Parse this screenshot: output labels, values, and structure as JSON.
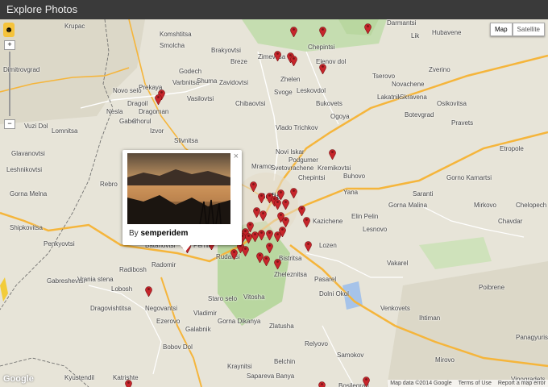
{
  "window": {
    "title": "Explore Photos"
  },
  "map_type": {
    "map": "Map",
    "satellite": "Satellite",
    "selected": "Map"
  },
  "zoom": {
    "in": "+",
    "out": "−"
  },
  "popup": {
    "by": "By",
    "author": "semperidem",
    "close": "×"
  },
  "attribution": {
    "data": "Map data ©2014 Google",
    "terms": "Terms of Use",
    "report": "Report a map error"
  },
  "logo": "Google",
  "colors": {
    "pin": "#c7252b",
    "park": "#b9d7a0",
    "highway": "#f5b53b",
    "road": "#ffffff",
    "water": "#a6c3e9",
    "border": "#555555"
  },
  "place_labels": [
    {
      "id": "krupac",
      "text": "Krupac"
    },
    {
      "id": "dimitrovgrad",
      "text": "Dimitrovgrad"
    },
    {
      "id": "komshtitsa",
      "text": "Komshtitsa"
    },
    {
      "id": "smolcha",
      "text": "Smolcha"
    },
    {
      "id": "brakyovtsi",
      "text": "Brakyovtsi"
    },
    {
      "id": "breze",
      "text": "Breze"
    },
    {
      "id": "zimevitsa",
      "text": "Zimevitsa"
    },
    {
      "id": "chepintsi",
      "text": "Chepintsi"
    },
    {
      "id": "godech",
      "text": "Godech"
    },
    {
      "id": "varbnitsa",
      "text": "Varbnitsa"
    },
    {
      "id": "shuma",
      "text": "Shuma"
    },
    {
      "id": "zavidovtsi",
      "text": "Zavidovtsi"
    },
    {
      "id": "novo-selo",
      "text": "Novo selo"
    },
    {
      "id": "prekaya",
      "text": "Prekaya"
    },
    {
      "id": "dragoman",
      "text": "Dragoman"
    },
    {
      "id": "vasilovtsi",
      "text": "Vasilovtsi"
    },
    {
      "id": "dragoil",
      "text": "Dragoil"
    },
    {
      "id": "nesla",
      "text": "Nesla"
    },
    {
      "id": "chiprovtsi-x",
      "text": "Chorul"
    },
    {
      "id": "gaber",
      "text": "Gaber"
    },
    {
      "id": "chibaovtsi",
      "text": "Chibaovtsi"
    },
    {
      "id": "svoge",
      "text": "Svoge"
    },
    {
      "id": "zheleni",
      "text": "Zhelen"
    },
    {
      "id": "leskovdol",
      "text": "Leskovdol"
    },
    {
      "id": "elenov-dol",
      "text": "Elenov dol"
    },
    {
      "id": "bukovets",
      "text": "Bukovets"
    },
    {
      "id": "ogoya",
      "text": "Ogoya"
    },
    {
      "id": "darmantsi",
      "text": "Darmantsi"
    },
    {
      "id": "lik",
      "text": "Lik"
    },
    {
      "id": "hubavene",
      "text": "Hubavene"
    },
    {
      "id": "tserovo",
      "text": "Tserovo"
    },
    {
      "id": "zverino",
      "text": "Zverino"
    },
    {
      "id": "novachene",
      "text": "Novachene"
    },
    {
      "id": "skravena",
      "text": "Skravena"
    },
    {
      "id": "lakatnik",
      "text": "Lakatnik"
    },
    {
      "id": "osikovitsa",
      "text": "Osikovitsa"
    },
    {
      "id": "botevgrad",
      "text": "Botevgrad"
    },
    {
      "id": "pravets",
      "text": "Pravets"
    },
    {
      "id": "etropole",
      "text": "Etropole"
    },
    {
      "id": "vlado-trichkov",
      "text": "Vlado Trichkov"
    },
    {
      "id": "slivnitsa",
      "text": "Slivnitsa"
    },
    {
      "id": "izvor",
      "text": "Izvor"
    },
    {
      "id": "vrazhdebna",
      "text": "Novi Iskar"
    },
    {
      "id": "mramor",
      "text": "Mramor"
    },
    {
      "id": "svetovrachene",
      "text": "Svetovrachene"
    },
    {
      "id": "podgumer",
      "text": "Podgumer"
    },
    {
      "id": "kremikovtsi",
      "text": "Kremikovtsi"
    },
    {
      "id": "buhovo",
      "text": "Buhovo"
    },
    {
      "id": "chepintsi2",
      "text": "Chepintsi"
    },
    {
      "id": "yana",
      "text": "Yana"
    },
    {
      "id": "gorno-kamartsi",
      "text": "Gorno Kamartsi"
    },
    {
      "id": "saranti",
      "text": "Saranti"
    },
    {
      "id": "mirkovo",
      "text": "Mirkovo"
    },
    {
      "id": "chelopech",
      "text": "Chelopech"
    },
    {
      "id": "chavdar",
      "text": "Chavdar"
    },
    {
      "id": "kazichene",
      "text": "Kazichene"
    },
    {
      "id": "elin-pelin",
      "text": "Elin Pelin"
    },
    {
      "id": "gorna-malina",
      "text": "Gorna Malina"
    },
    {
      "id": "lesnovo",
      "text": "Lesnovo"
    },
    {
      "id": "lozen",
      "text": "Lozen"
    },
    {
      "id": "glavanovtsi",
      "text": "Glavanovtsi"
    },
    {
      "id": "leshnikovtsi",
      "text": "Leshnikovtsi"
    },
    {
      "id": "gorna-melna",
      "text": "Gorna Melna"
    },
    {
      "id": "rebro",
      "text": "Rebro"
    },
    {
      "id": "shipkovitsa",
      "text": "Shipkovitsa"
    },
    {
      "id": "penkyovtsi",
      "text": "Penkyovtsi"
    },
    {
      "id": "batanovtsi",
      "text": "Batanovtsi"
    },
    {
      "id": "radomir",
      "text": "Radomir"
    },
    {
      "id": "radibosh",
      "text": "Radibosh"
    },
    {
      "id": "gabreshevtsi",
      "text": "Gabreshevtsi"
    },
    {
      "id": "vrania-stena",
      "text": "Vrania stena"
    },
    {
      "id": "lobosh",
      "text": "Lobosh"
    },
    {
      "id": "negovantsi",
      "text": "Negovantsi"
    },
    {
      "id": "bistritsa",
      "text": "Bistritsa"
    },
    {
      "id": "zheleznitsa",
      "text": "Zheleznitsa"
    },
    {
      "id": "vitosha",
      "text": "Vitosha"
    },
    {
      "id": "pernik",
      "text": "Pernik"
    },
    {
      "id": "rudartsi",
      "text": "Rudartsi"
    },
    {
      "id": "stara-reka",
      "text": "Staro selo"
    },
    {
      "id": "vakarel",
      "text": "Vakarel"
    },
    {
      "id": "poibrene",
      "text": "Poibrene"
    },
    {
      "id": "dolni-okol",
      "text": "Dolni Okol"
    },
    {
      "id": "venkovets",
      "text": "Venkovets"
    },
    {
      "id": "ihtiman",
      "text": "Ihtiman"
    },
    {
      "id": "vladimir",
      "text": "Vladimir"
    },
    {
      "id": "dragovishtitsa",
      "text": "Dragovishtitsa"
    },
    {
      "id": "gorna-dikanya",
      "text": "Gorna Dikanya"
    },
    {
      "id": "galabnik",
      "text": "Galabnik"
    },
    {
      "id": "zlatusha",
      "text": "Zlatusha"
    },
    {
      "id": "bobov-dol",
      "text": "Bobov Dol"
    },
    {
      "id": "relyovo",
      "text": "Relyovo"
    },
    {
      "id": "samokov",
      "text": "Samokov"
    },
    {
      "id": "kyustendil",
      "text": "Kyustendil"
    },
    {
      "id": "katrishte",
      "text": "Katrishte"
    },
    {
      "id": "sapareva-banya",
      "text": "Sapareva Banya"
    },
    {
      "id": "kraynitsi",
      "text": "Kraynitsi"
    },
    {
      "id": "panagyurishte",
      "text": "Panagyurishte"
    },
    {
      "id": "vinogradets",
      "text": "Vinogradets"
    },
    {
      "id": "mirovo",
      "text": "Mirovo"
    },
    {
      "id": "bosilegrad",
      "text": "Bosilegrad"
    },
    {
      "id": "lomnitsa",
      "text": "Lomnitsa"
    },
    {
      "id": "vuzi-dol",
      "text": "Vuzi Dol"
    },
    {
      "id": "ezerovo",
      "text": "Ezerovo"
    },
    {
      "id": "pasarel",
      "text": "Pasarel"
    },
    {
      "id": "belchin",
      "text": "Belchin"
    },
    {
      "id": "sofia",
      "text": "Sofia"
    }
  ]
}
